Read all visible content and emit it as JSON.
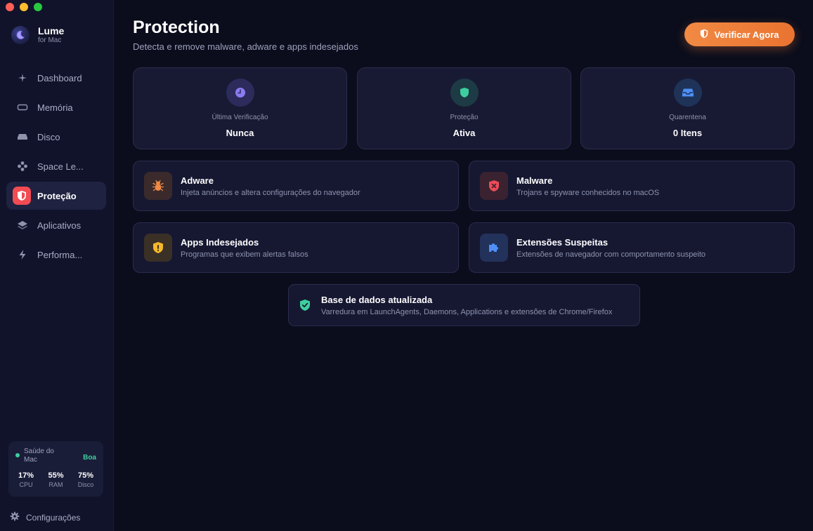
{
  "brand": {
    "name": "Lume",
    "sub": "for Mac"
  },
  "sidebar": {
    "items": [
      {
        "label": "Dashboard",
        "icon": "sparkle-icon"
      },
      {
        "label": "Memória",
        "icon": "memory-icon"
      },
      {
        "label": "Disco",
        "icon": "disk-icon"
      },
      {
        "label": "Space Le...",
        "icon": "space-lens-icon"
      },
      {
        "label": "Proteção",
        "icon": "shield-icon",
        "active": true
      },
      {
        "label": "Aplicativos",
        "icon": "layers-icon"
      },
      {
        "label": "Performa...",
        "icon": "bolt-icon"
      }
    ],
    "health": {
      "label": "Saúde do Mac",
      "status": "Boa",
      "stats": [
        {
          "value": "17%",
          "label": "CPU"
        },
        {
          "value": "55%",
          "label": "RAM"
        },
        {
          "value": "75%",
          "label": "Disco"
        }
      ]
    },
    "settings_label": "Configurações"
  },
  "header": {
    "title": "Protection",
    "subtitle": "Detecta e remove malware, adware e apps indesejados",
    "scan_button": "Verificar Agora"
  },
  "stats": [
    {
      "label": "Última Verificação",
      "value": "Nunca",
      "icon": "clock-icon"
    },
    {
      "label": "Proteção",
      "value": "Ativa",
      "icon": "shield-icon"
    },
    {
      "label": "Quarentena",
      "value": "0 Itens",
      "icon": "tray-icon"
    }
  ],
  "threats": [
    {
      "title": "Adware",
      "desc": "Injeta anúncios e altera configurações do navegador",
      "icon": "bug-icon"
    },
    {
      "title": "Malware",
      "desc": "Trojans e spyware conhecidos no macOS",
      "icon": "x-shield-icon"
    },
    {
      "title": "Apps Indesejados",
      "desc": "Programas que exibem alertas falsos",
      "icon": "warning-shield-icon"
    },
    {
      "title": "Extensões Suspeitas",
      "desc": "Extensões de navegador com comportamento suspeito",
      "icon": "puzzle-icon"
    }
  ],
  "database": {
    "title": "Base de dados atualizada",
    "desc": "Varredura em LaunchAgents, Daemons, Applications e extensões de Chrome/Firefox"
  },
  "colors": {
    "accent": "#ee7e3a",
    "active_nav": "#f24b53",
    "health_ok": "#3ecf9e"
  }
}
